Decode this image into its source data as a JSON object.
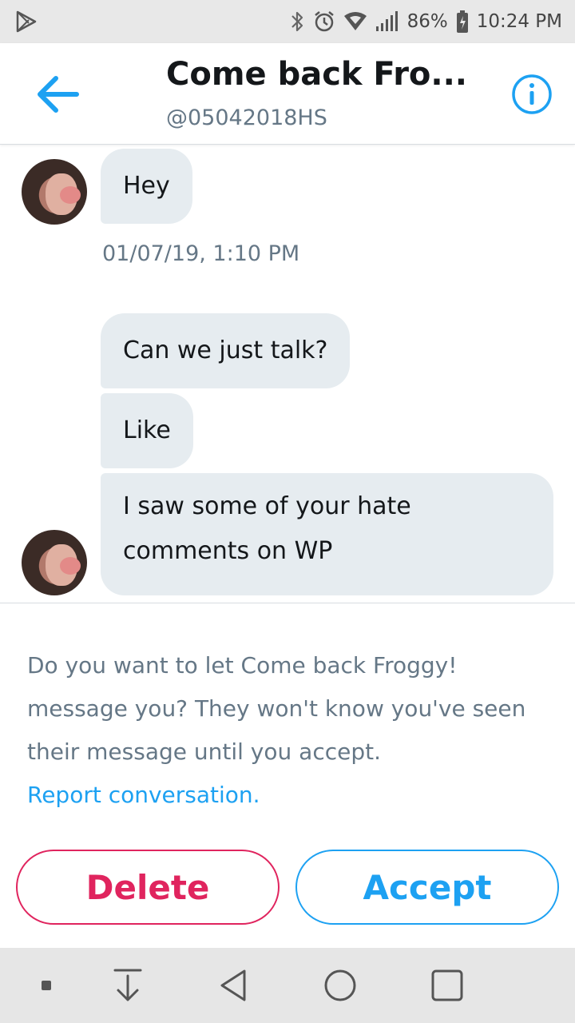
{
  "status_bar": {
    "battery": "86%",
    "time": "10:24 PM",
    "icons": [
      "play-store-icon",
      "bluetooth-icon",
      "alarm-icon",
      "wifi-icon",
      "signal-icon",
      "battery-icon"
    ]
  },
  "header": {
    "title": "Come back Fro...",
    "handle": "@05042018HS",
    "back_icon": "arrow-left-icon",
    "info_icon": "info-icon",
    "accent": "#1da1f2"
  },
  "messages": [
    {
      "text": "Hey"
    },
    {
      "text": "Can we just talk?"
    },
    {
      "text": "Like"
    },
    {
      "text": "I saw some of your hate comments on WP"
    }
  ],
  "timestamp": "01/07/19, 1:10 PM",
  "request": {
    "prompt": "Do you want to let Come back Froggy! message you? They won't know you've seen their message until you accept.",
    "report_link": "Report conversation."
  },
  "actions": {
    "delete_label": "Delete",
    "accept_label": "Accept",
    "delete_color": "#e0245e",
    "accept_color": "#1da1f2"
  },
  "nav_bar": {
    "icons": [
      "dot-icon",
      "download-icon",
      "back-triangle-icon",
      "home-circle-icon",
      "recents-square-icon"
    ]
  }
}
